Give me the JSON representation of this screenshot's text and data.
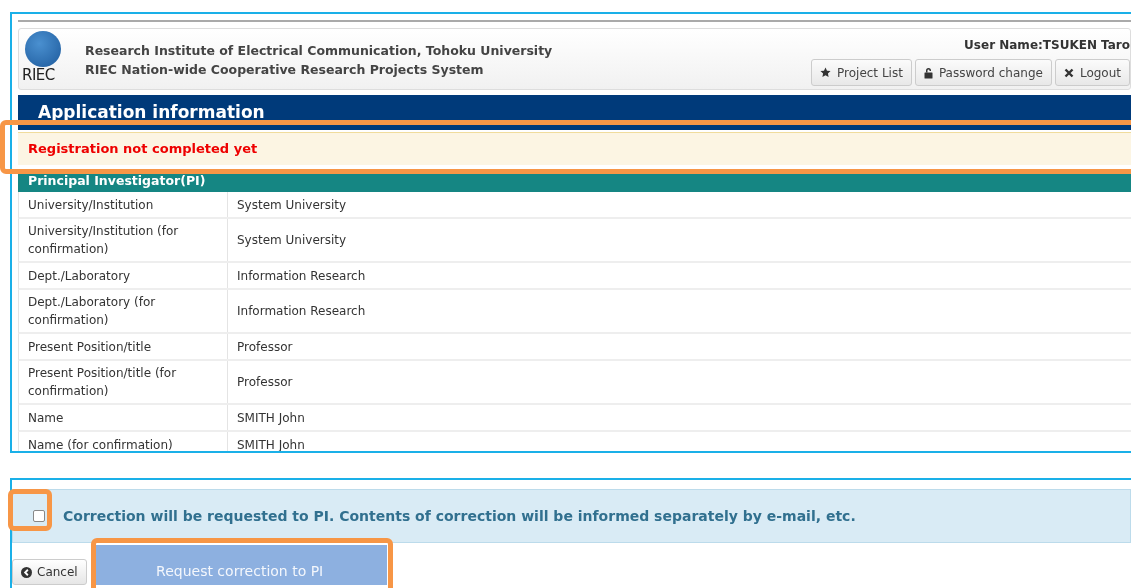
{
  "header": {
    "logo_text": "RIEC",
    "institute": "Research Institute of Electrical Communication, Tohoku University",
    "system": "RIEC Nation-wide Cooperative Research Projects System",
    "user": "User Name:TSUKEN Taro",
    "buttons": [
      {
        "kind": "star",
        "label": "Project List"
      },
      {
        "kind": "lock",
        "label": "Password change"
      },
      {
        "kind": "close",
        "label": "Logout"
      }
    ]
  },
  "page_title": "Application information",
  "message": "Registration not completed yet",
  "table": {
    "section": "Principal Investigator(PI)",
    "rows": [
      {
        "label": "University/Institution",
        "value": "System University"
      },
      {
        "label": "University/Institution (for confirmation)",
        "value": "System University"
      },
      {
        "label": "Dept./Laboratory",
        "value": "Information Research"
      },
      {
        "label": "Dept./Laboratory (for confirmation)",
        "value": "Information Research"
      },
      {
        "label": "Present Position/title",
        "value": "Professor"
      },
      {
        "label": "Present Position/title (for confirmation)",
        "value": "Professor"
      },
      {
        "label": "Name",
        "value": "SMITH John"
      },
      {
        "label": "Name (for confirmation)",
        "value": "SMITH John"
      }
    ]
  },
  "correction": {
    "checked": false,
    "text": "Correction will be requested to PI. Contents of correction will be informed separately by e-mail, etc."
  },
  "cancel_button": "Cancel",
  "request_button": {
    "label": "Request correction to PI",
    "disabled": true
  }
}
